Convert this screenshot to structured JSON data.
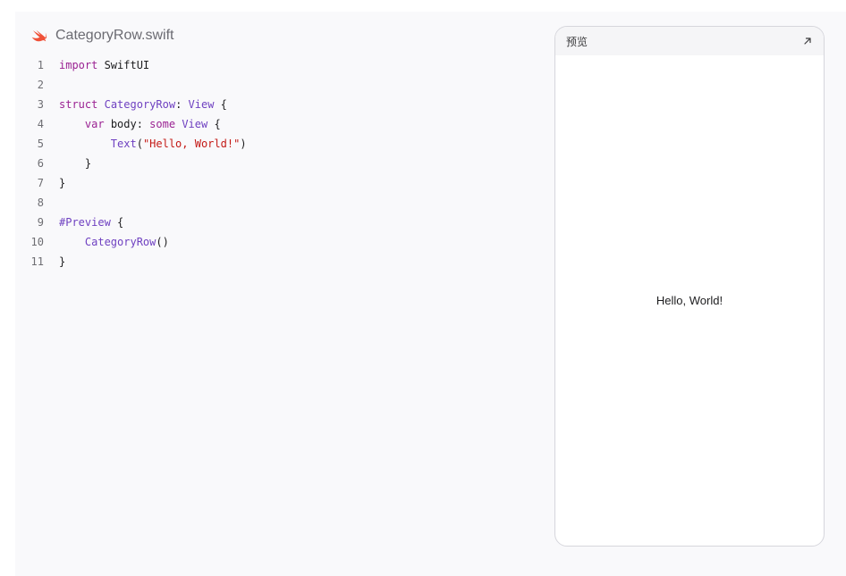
{
  "file": {
    "icon": "swift-icon",
    "name": "CategoryRow.swift"
  },
  "code": {
    "lines": [
      {
        "n": "1",
        "tokens": [
          {
            "t": "import",
            "c": "kw"
          },
          {
            "t": " SwiftUI",
            "c": ""
          }
        ]
      },
      {
        "n": "2",
        "tokens": []
      },
      {
        "n": "3",
        "tokens": [
          {
            "t": "struct",
            "c": "kw"
          },
          {
            "t": " ",
            "c": ""
          },
          {
            "t": "CategoryRow",
            "c": "ty"
          },
          {
            "t": ": ",
            "c": ""
          },
          {
            "t": "View",
            "c": "ty"
          },
          {
            "t": " {",
            "c": ""
          }
        ]
      },
      {
        "n": "4",
        "tokens": [
          {
            "t": "    ",
            "c": ""
          },
          {
            "t": "var",
            "c": "kw"
          },
          {
            "t": " body: ",
            "c": ""
          },
          {
            "t": "some",
            "c": "kw"
          },
          {
            "t": " ",
            "c": ""
          },
          {
            "t": "View",
            "c": "ty"
          },
          {
            "t": " {",
            "c": ""
          }
        ]
      },
      {
        "n": "5",
        "tokens": [
          {
            "t": "        ",
            "c": ""
          },
          {
            "t": "Text",
            "c": "ty"
          },
          {
            "t": "(",
            "c": ""
          },
          {
            "t": "\"Hello, World!\"",
            "c": "str"
          },
          {
            "t": ")",
            "c": ""
          }
        ]
      },
      {
        "n": "6",
        "tokens": [
          {
            "t": "    }",
            "c": ""
          }
        ]
      },
      {
        "n": "7",
        "tokens": [
          {
            "t": "}",
            "c": ""
          }
        ]
      },
      {
        "n": "8",
        "tokens": []
      },
      {
        "n": "9",
        "tokens": [
          {
            "t": "#Preview",
            "c": "pv"
          },
          {
            "t": " {",
            "c": ""
          }
        ]
      },
      {
        "n": "10",
        "tokens": [
          {
            "t": "    ",
            "c": ""
          },
          {
            "t": "CategoryRow",
            "c": "ty"
          },
          {
            "t": "()",
            "c": ""
          }
        ]
      },
      {
        "n": "11",
        "tokens": [
          {
            "t": "}",
            "c": ""
          }
        ]
      }
    ]
  },
  "preview": {
    "title": "预览",
    "expand_icon": "arrow-up-right-icon",
    "content_text": "Hello, World!"
  }
}
